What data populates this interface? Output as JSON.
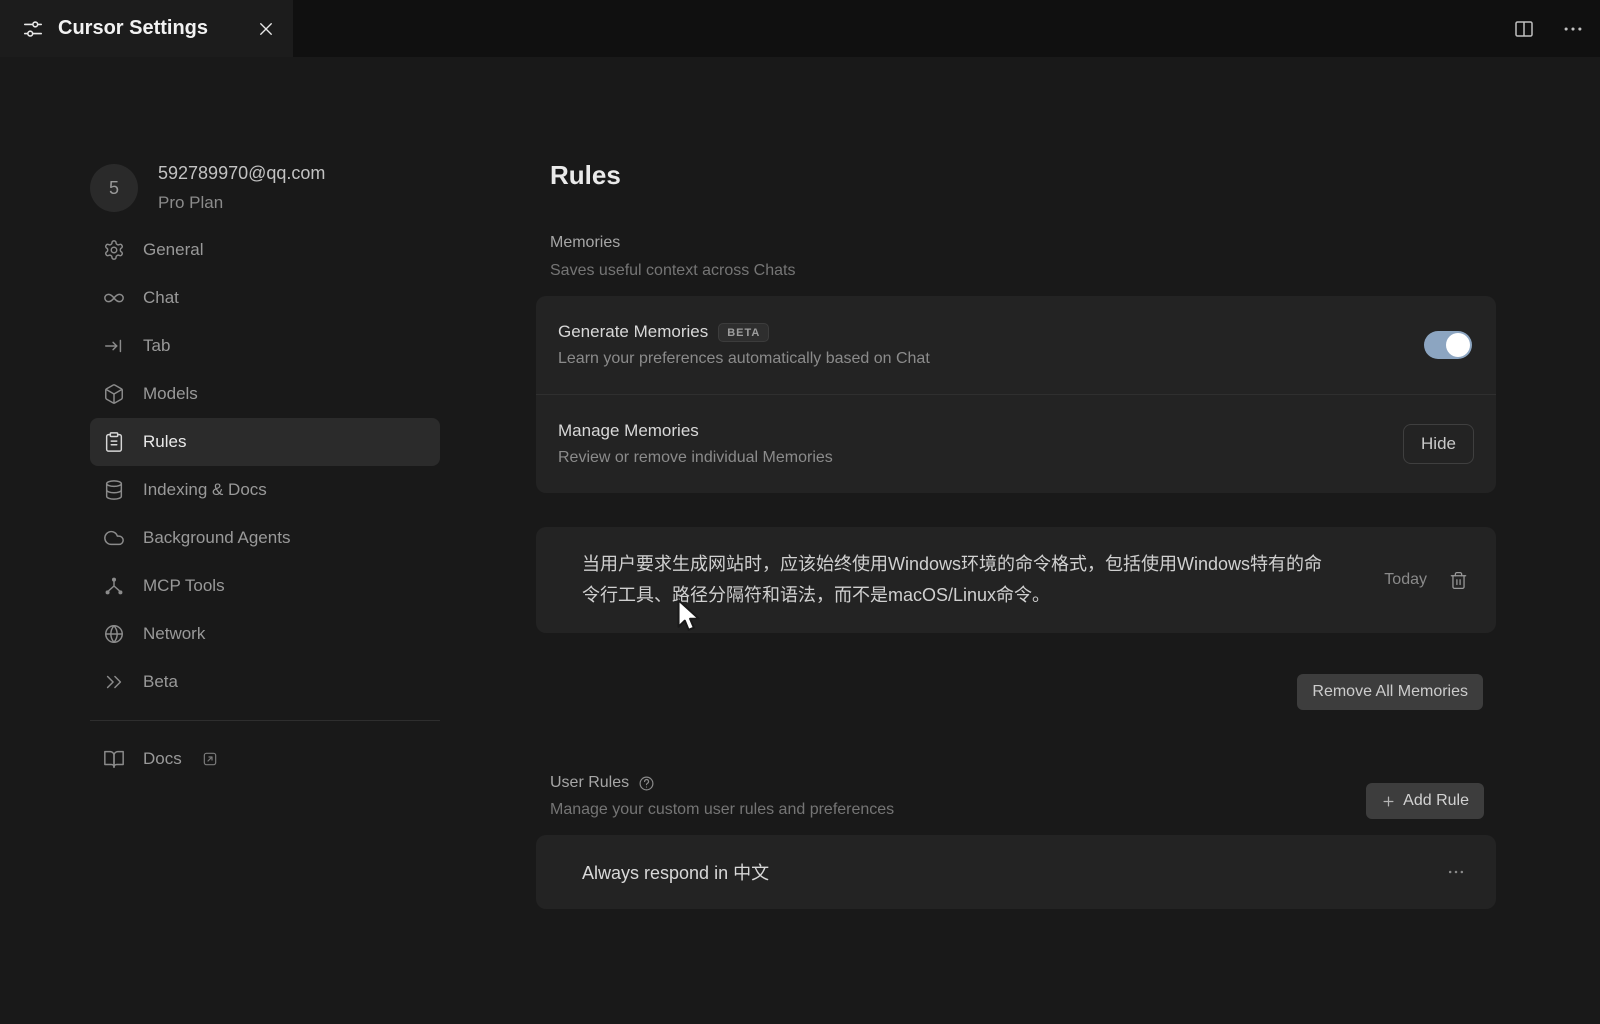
{
  "tab_bar": {
    "title": "Cursor Settings"
  },
  "sidebar": {
    "account": {
      "avatar_text": "5",
      "email": "592789970@qq.com",
      "plan": "Pro Plan"
    },
    "items": [
      {
        "label": "General"
      },
      {
        "label": "Chat"
      },
      {
        "label": "Tab"
      },
      {
        "label": "Models"
      },
      {
        "label": "Rules"
      },
      {
        "label": "Indexing & Docs"
      },
      {
        "label": "Background Agents"
      },
      {
        "label": "MCP Tools"
      },
      {
        "label": "Network"
      },
      {
        "label": "Beta"
      }
    ],
    "docs_label": "Docs"
  },
  "main": {
    "title": "Rules",
    "memories_section": {
      "heading": "Memories",
      "subheading": "Saves useful context across Chats"
    },
    "generate_memories": {
      "title": "Generate Memories",
      "badge": "BETA",
      "subtitle": "Learn your preferences automatically based on Chat",
      "toggle_state": "on"
    },
    "manage_memories": {
      "title": "Manage Memories",
      "subtitle": "Review or remove individual Memories",
      "button_label": "Hide"
    },
    "memory_item": {
      "text": "当用户要求生成网站时，应该始终使用Windows环境的命令格式，包括使用Windows特有的命令行工具、路径分隔符和语法，而不是macOS/Linux命令。",
      "date": "Today"
    },
    "remove_all_label": "Remove All Memories",
    "user_rules": {
      "heading": "User Rules",
      "subheading": "Manage your custom user rules and preferences",
      "add_button_label": "Add Rule"
    },
    "rule_item": {
      "text": "Always respond in 中文"
    }
  },
  "colors": {
    "toggle_on": "#8ca5c1",
    "card_bg": "#232323",
    "page_bg": "#191919",
    "selected_item_bg": "#2b2b2b"
  }
}
